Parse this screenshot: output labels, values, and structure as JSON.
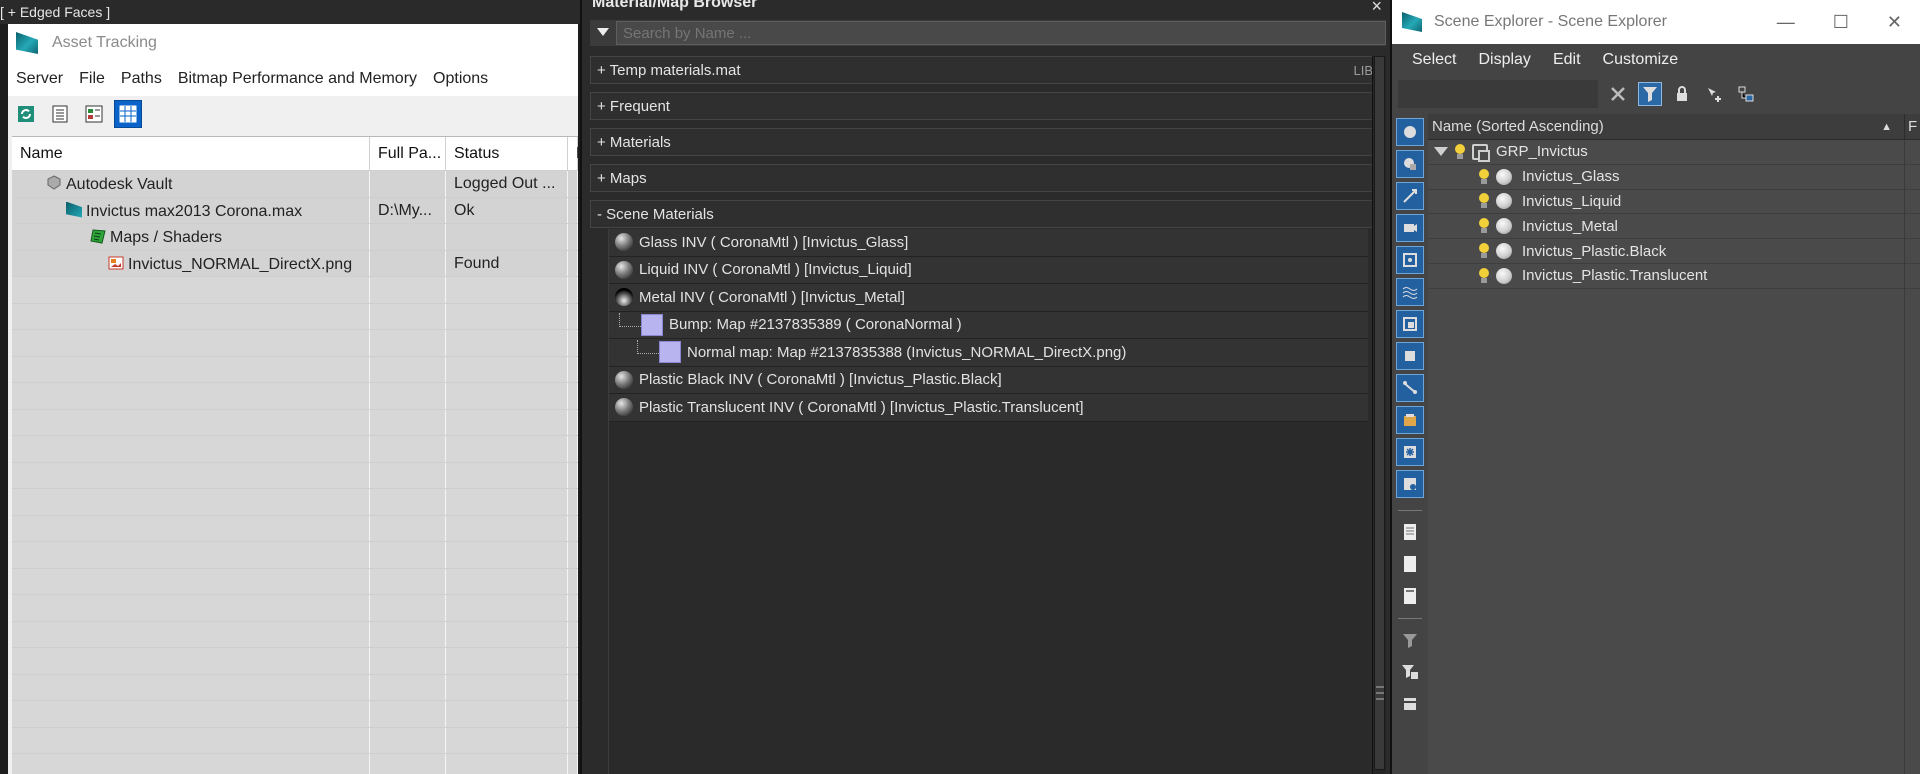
{
  "viewport": {
    "label": "[ + Edged Faces ]"
  },
  "asset_tracking": {
    "title": "Asset Tracking",
    "menu": [
      "Server",
      "File",
      "Paths",
      "Bitmap Performance and Memory",
      "Options"
    ],
    "toolbar_icons": [
      "refresh-icon",
      "list-icon",
      "detail-icon",
      "table-icon"
    ],
    "columns": [
      "Name",
      "Full Pa...",
      "Status",
      "F"
    ],
    "rows": [
      {
        "name": "Autodesk Vault",
        "path": "",
        "status": "Logged Out ...",
        "icon": "vault-icon"
      },
      {
        "name": "Invictus max2013 Corona.max",
        "path": "D:\\My...",
        "status": "Ok",
        "icon": "max-file-icon"
      },
      {
        "name": "Maps / Shaders",
        "path": "",
        "status": "",
        "icon": "maps-folder-icon"
      },
      {
        "name": "Invictus_NORMAL_DirectX.png",
        "path": "",
        "status": "Found",
        "icon": "image-file-icon"
      }
    ]
  },
  "material_browser": {
    "title": "Material/Map Browser",
    "close_glyph": "×",
    "search_placeholder": "Search by Name ...",
    "groups": [
      {
        "label": "+ Temp materials.mat",
        "tag": "LIB"
      },
      {
        "label": "+ Frequent",
        "tag": ""
      },
      {
        "label": "+ Materials",
        "tag": ""
      },
      {
        "label": "+ Maps",
        "tag": ""
      },
      {
        "label": "- Scene Materials",
        "tag": ""
      }
    ],
    "scene_materials": [
      "Glass INV  ( CoronaMtl ) [Invictus_Glass]",
      "Liquid INV  ( CoronaMtl ) [Invictus_Liquid]",
      "Metal INV  ( CoronaMtl ) [Invictus_Metal]",
      "Bump: Map #2137835389  ( CoronaNormal )",
      "Normal map: Map #2137835388 (Invictus_NORMAL_DirectX.png)",
      "Plastic Black INV  ( CoronaMtl ) [Invictus_Plastic.Black]",
      "Plastic Translucent INV  ( CoronaMtl ) [Invictus_Plastic.Translucent]"
    ]
  },
  "scene_explorer": {
    "title": "Scene Explorer - Scene Explorer",
    "window_buttons": [
      "—",
      "☐",
      "✕"
    ],
    "menu": [
      "Select",
      "Display",
      "Edit",
      "Customize"
    ],
    "column_header": "Name (Sorted Ascending)",
    "sort_glyph": "▲",
    "second_col": "F",
    "root": "GRP_Invictus",
    "objects": [
      "Invictus_Glass",
      "Invictus_Liquid",
      "Invictus_Metal",
      "Invictus_Plastic.Black",
      "Invictus_Plastic.Translucent"
    ]
  }
}
